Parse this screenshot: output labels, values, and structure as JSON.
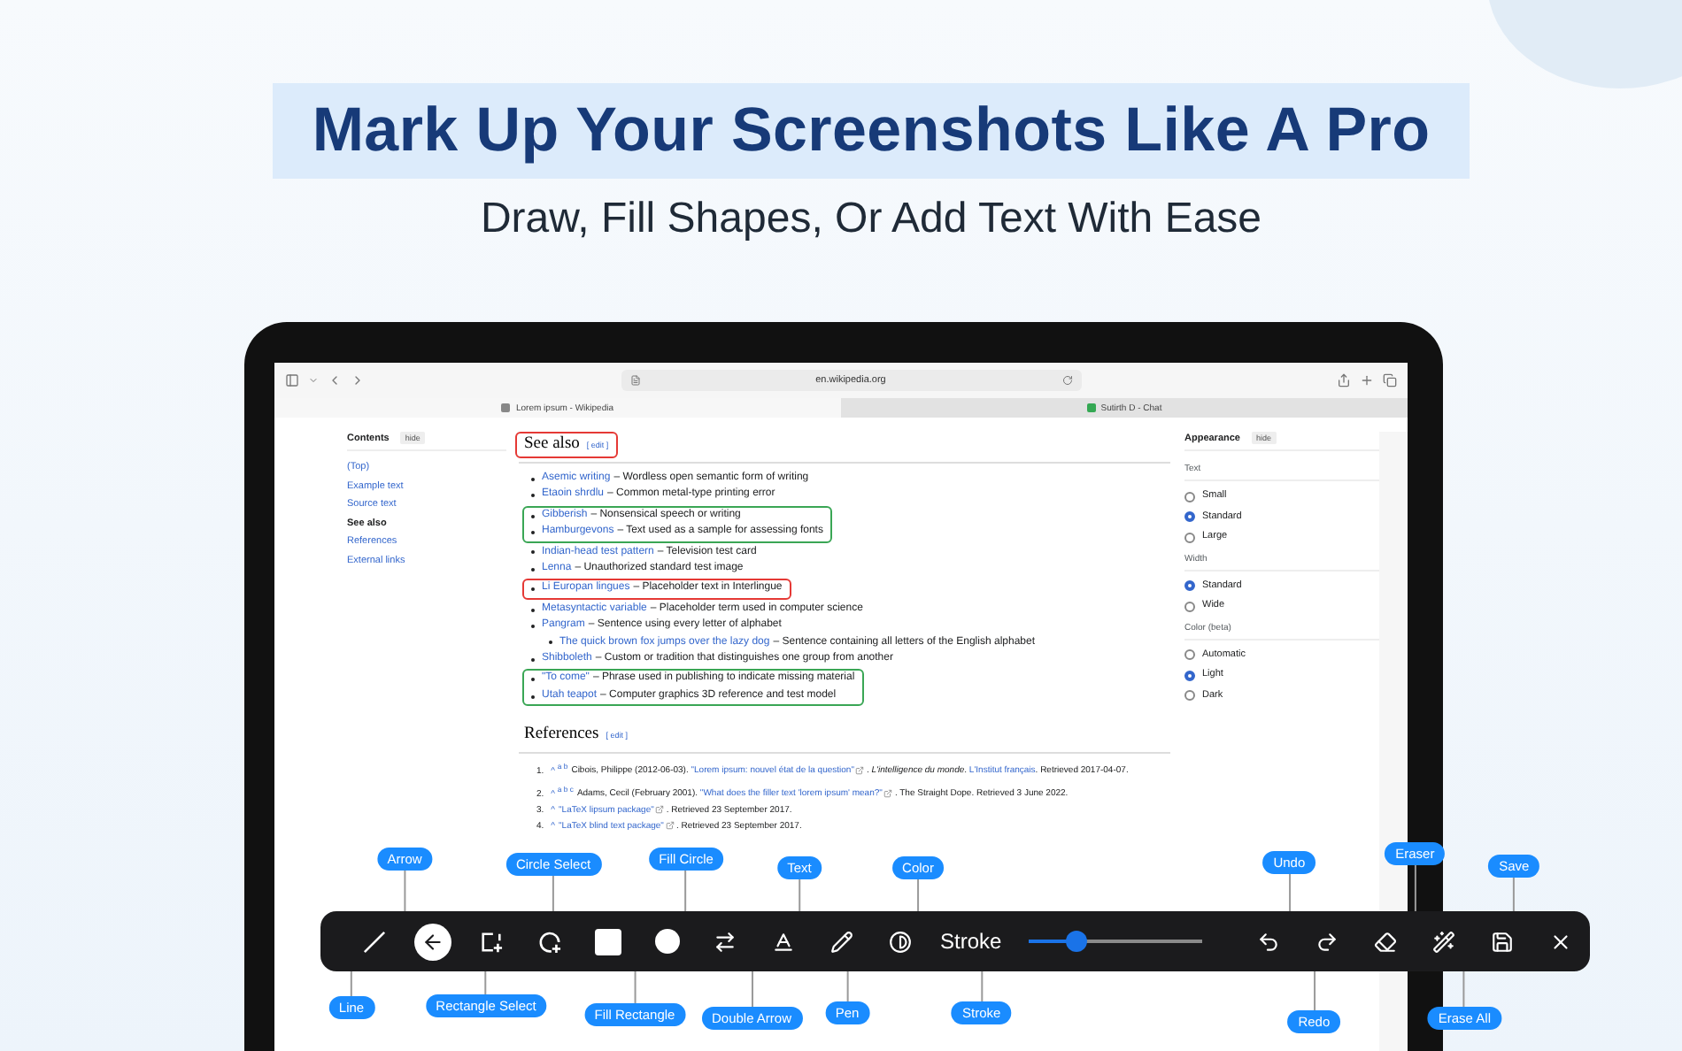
{
  "headline": "Mark Up Your Screenshots Like A Pro",
  "subheadline": "Draw, Fill Shapes, Or Add Text With Ease",
  "browser": {
    "url": "en.wikipedia.org",
    "tabs": [
      {
        "title": "Lorem ipsum - Wikipedia",
        "selected": true
      },
      {
        "title": "Sutirth D - Chat",
        "selected": false
      }
    ]
  },
  "toc": {
    "title": "Contents",
    "hide": "hide",
    "items": [
      {
        "label": "(Top)",
        "selected": false
      },
      {
        "label": "Example text",
        "selected": false
      },
      {
        "label": "Source text",
        "selected": false
      },
      {
        "label": "See also",
        "selected": true
      },
      {
        "label": "References",
        "selected": false
      },
      {
        "label": "External links",
        "selected": false
      }
    ]
  },
  "see_also": {
    "title": "See also",
    "edit": "[ edit ]",
    "color": "#e53935",
    "groups": [
      {
        "items": [
          {
            "link": "Asemic writing",
            "text": "– Wordless open semantic form of writing"
          },
          {
            "link": "Etaoin shrdlu",
            "text": "– Common metal-type printing error"
          }
        ]
      },
      {
        "color": "#3aa655",
        "items": [
          {
            "link": "Gibberish",
            "text": "– Nonsensical speech or writing"
          },
          {
            "link": "Hamburgevons",
            "text": "– Text used as a sample for assessing fonts"
          }
        ]
      },
      {
        "items": [
          {
            "link": "Indian-head test pattern",
            "text": "– Television test card"
          },
          {
            "link": "Lenna",
            "text": "– Unauthorized standard test image"
          }
        ]
      },
      {
        "color": "#e53935",
        "items": [
          {
            "link": "Li Europan lingues",
            "text": "– Placeholder text in Interlingue"
          }
        ]
      },
      {
        "items": [
          {
            "link": "Metasyntactic variable",
            "text": "– Placeholder term used in computer science"
          },
          {
            "link": "Pangram",
            "text": "– Sentence using every letter of alphabet",
            "children": [
              {
                "link": "The quick brown fox jumps over the lazy dog",
                "text": "– Sentence containing all letters of the English alphabet"
              }
            ]
          },
          {
            "link": "Shibboleth",
            "text": "– Custom or tradition that distinguishes one group from another"
          }
        ]
      },
      {
        "color": "#3aa655",
        "items": [
          {
            "link": "\"To come\"",
            "text": "– Phrase used in publishing to indicate missing material"
          },
          {
            "link": "Utah teapot",
            "text": "– Computer graphics 3D reference and test model"
          }
        ]
      }
    ]
  },
  "references": {
    "title": "References",
    "edit": "[ edit ]",
    "items": [
      {
        "number": "1.",
        "backrefs": "^ $^{a b}$",
        "segments": [
          {
            "text": "Cibois, Philippe (2012-06-03). "
          },
          {
            "text": "\"Lorem ipsum: nouvel état de la question\"",
            "link": true,
            "external": true
          },
          {
            "text": ". *L'intelligence du monde*. "
          },
          {
            "text": "L'Institut français",
            "link": true
          },
          {
            "text": ". Retrieved 2017-04-07."
          }
        ]
      },
      {
        "number": "2.",
        "backrefs": "^ $^{a b c}$",
        "segments": [
          {
            "text": "Adams, Cecil (February 2001). "
          },
          {
            "text": "\"What does the filler text 'lorem ipsum' mean?\"",
            "link": true,
            "external": true
          },
          {
            "text": ". The Straight Dope. Retrieved 3 June 2022."
          }
        ]
      },
      {
        "number": "3.",
        "backrefs": "^",
        "segments": [
          {
            "text": "\"LaTeX lipsum package\"",
            "link": true,
            "external": true
          },
          {
            "text": ". Retrieved 23 September 2017."
          }
        ]
      },
      {
        "number": "4.",
        "backrefs": "^",
        "segments": [
          {
            "text": "\"LaTeX blind text package\"",
            "link": true,
            "external": true
          },
          {
            "text": ". Retrieved 23 September 2017."
          }
        ]
      }
    ]
  },
  "appearance": {
    "title": "Appearance",
    "hide": "hide",
    "sections": [
      {
        "title": "Text",
        "options": [
          {
            "label": "Small",
            "selected": false
          },
          {
            "label": "Standard",
            "selected": true
          },
          {
            "label": "Large",
            "selected": false
          }
        ]
      },
      {
        "title": "Width",
        "options": [
          {
            "label": "Standard",
            "selected": true
          },
          {
            "label": "Wide",
            "selected": false
          }
        ]
      },
      {
        "title": "Color (beta)",
        "options": [
          {
            "label": "Automatic",
            "selected": false
          },
          {
            "label": "Light",
            "selected": true
          },
          {
            "label": "Dark",
            "selected": false
          }
        ]
      }
    ]
  },
  "toolbar": {
    "tools": [
      {
        "kind": "line",
        "callout": "Line",
        "selected": false
      },
      {
        "kind": "arrow",
        "callout": "Arrow",
        "selected": true
      },
      {
        "kind": "rect_select",
        "callout": "Rectangle Select",
        "selected": false
      },
      {
        "kind": "circle_select",
        "callout": "Circle Select",
        "selected": false
      },
      {
        "kind": "fill_rect",
        "callout": "Fill Rectangle",
        "selected": false
      },
      {
        "kind": "fill_circle",
        "callout": "Fill Circle",
        "selected": false
      },
      {
        "kind": "double_arrow",
        "callout": "Double Arrow",
        "selected": false
      },
      {
        "kind": "text",
        "callout": "Text",
        "selected": false
      },
      {
        "kind": "pen",
        "callout": "Pen",
        "selected": false
      },
      {
        "kind": "color",
        "callout": "Color",
        "selected": false
      },
      {
        "kind": "stroke",
        "label": "Stroke",
        "callout": "Stroke",
        "level": 0.28
      },
      {
        "kind": "undo",
        "callout": "Undo",
        "selected": false
      },
      {
        "kind": "redo",
        "callout": "Redo",
        "selected": false
      },
      {
        "kind": "eraser",
        "callout": "Eraser",
        "selected": false
      },
      {
        "kind": "erase_all",
        "callout": "Erase All",
        "selected": false
      },
      {
        "kind": "save",
        "callout": "Save",
        "selected": false
      },
      {
        "kind": "close",
        "selected": false
      }
    ]
  }
}
